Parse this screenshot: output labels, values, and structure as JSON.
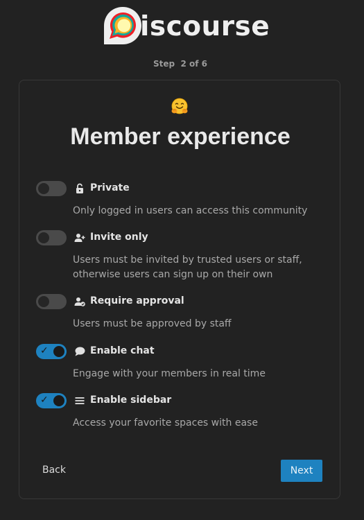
{
  "header": {
    "logo_text": "iscourse",
    "step_label": "Step  2 of 6"
  },
  "card": {
    "emoji": "hugging-face-emoji",
    "title": "Member experience"
  },
  "options": [
    {
      "icon": "unlock-icon",
      "label": "Private",
      "description": "Only logged in users can access this community",
      "enabled": false
    },
    {
      "icon": "user-plus-icon",
      "label": "Invite only",
      "description": "Users must be invited by trusted users or staff, otherwise users can sign up on their own",
      "enabled": false
    },
    {
      "icon": "user-check-icon",
      "label": "Require approval",
      "description": "Users must be approved by staff",
      "enabled": false
    },
    {
      "icon": "comment-icon",
      "label": "Enable chat",
      "description": "Engage with your members in real time",
      "enabled": true
    },
    {
      "icon": "bars-icon",
      "label": "Enable sidebar",
      "description": "Access your favorite spaces with ease",
      "enabled": true
    }
  ],
  "footer": {
    "back_label": "Back",
    "next_label": "Next"
  },
  "colors": {
    "background": "#222222",
    "accent": "#1e82c0",
    "toggle_off": "#4a4a4a"
  }
}
